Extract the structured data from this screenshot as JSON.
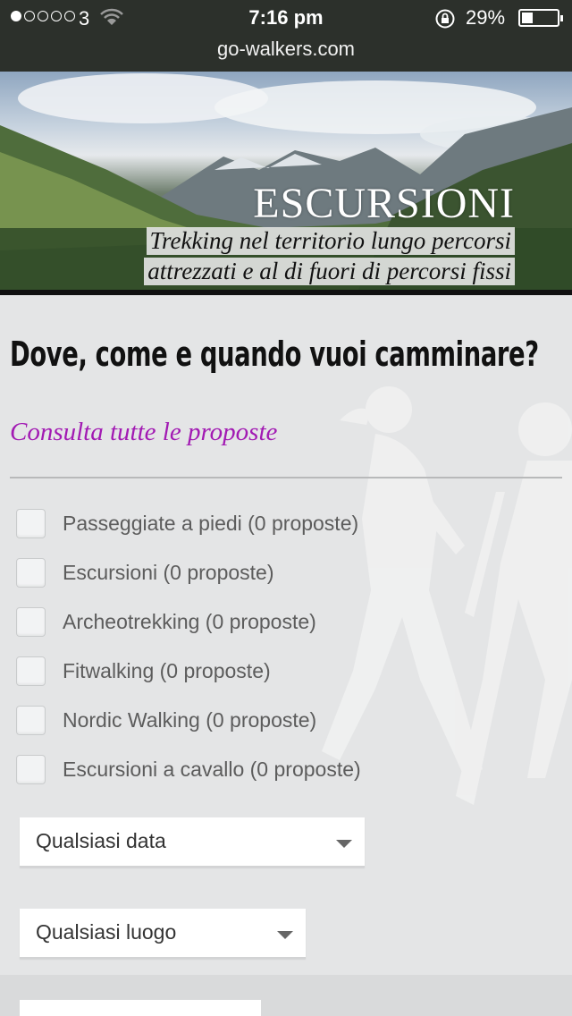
{
  "status_bar": {
    "carrier": "3",
    "time": "7:16 pm",
    "battery": "29%",
    "signal_bars_filled": 1,
    "signal_bars_total": 5,
    "icons": [
      "wifi-icon",
      "orientation-lock-icon",
      "battery-icon"
    ]
  },
  "browser": {
    "url": "go-walkers.com"
  },
  "hero": {
    "title": "ESCURSIONI",
    "subtitle_line1": "Trekking nel territorio lungo percorsi",
    "subtitle_line2": "attrezzati e al di fuori di percorsi fissi"
  },
  "main": {
    "headline": "Dove, come e quando vuoi camminare?",
    "link_all": "Consulta tutte le proposte",
    "filters": [
      {
        "label": "Passeggiate a piedi (0 proposte)",
        "checked": false
      },
      {
        "label": "Escursioni (0 proposte)",
        "checked": false
      },
      {
        "label": "Archeotrekking (0 proposte)",
        "checked": false
      },
      {
        "label": "Fitwalking (0 proposte)",
        "checked": false
      },
      {
        "label": "Nordic Walking (0 proposte)",
        "checked": false
      },
      {
        "label": "Escursioni a cavallo (0 proposte)",
        "checked": false
      }
    ],
    "select_date": {
      "value": "Qualsiasi data"
    },
    "select_place": {
      "value": "Qualsiasi luogo"
    }
  },
  "colors": {
    "status_bg": "#2c302b",
    "link": "#a21ab3",
    "headline": "#111111",
    "page_bg": "#e4e5e6"
  }
}
